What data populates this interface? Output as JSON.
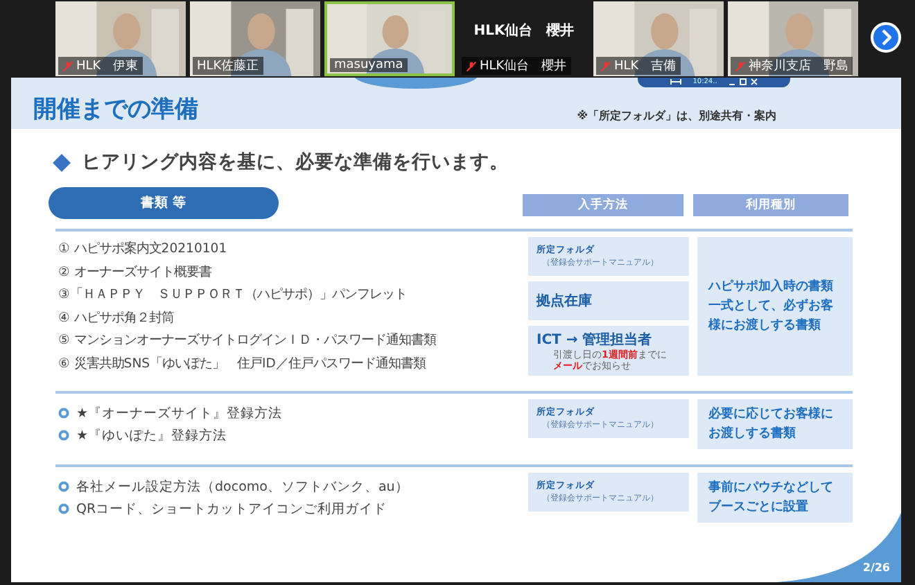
{
  "participants": [
    {
      "name": "HLK　伊東",
      "muted": true,
      "selected": false,
      "kind": "video"
    },
    {
      "name": "HLK佐藤正",
      "muted": false,
      "selected": false,
      "kind": "video"
    },
    {
      "name": "masuyama",
      "muted": false,
      "selected": true,
      "kind": "video"
    },
    {
      "name": "HLK仙台　櫻井",
      "muted": true,
      "selected": false,
      "kind": "name_only",
      "display_name": "HLK仙台　櫻井"
    },
    {
      "name": "HLK　吉備",
      "muted": true,
      "selected": false,
      "kind": "video"
    },
    {
      "name": "神奈川支店　野島",
      "muted": true,
      "selected": false,
      "kind": "video"
    }
  ],
  "share_toolbar": {
    "time": "10:24.."
  },
  "slide": {
    "title": "開催までの準備",
    "note": "※「所定フォルダ」は、別途共有・案内",
    "heading": "ヒアリング内容を基に、必要な準備を行います。",
    "category": "書類 等",
    "column_headers": [
      "入手方法",
      "利用種別"
    ],
    "sections": [
      {
        "items": [
          {
            "kind": "numbered",
            "text": "① ハピサポ案内文20210101"
          },
          {
            "kind": "numbered",
            "text": "② オーナーズサイト概要書"
          },
          {
            "kind": "numbered",
            "text": "③「ＨＡＰＰＹ　ＳＵＰＰＯＲＴ（ハピサポ）」パンフレット"
          },
          {
            "kind": "numbered",
            "text": "④ ハピサポ角２封筒"
          },
          {
            "kind": "numbered",
            "text": "⑤ マンションオーナーズサイトログインＩＤ・パスワード通知書類"
          },
          {
            "kind": "numbered",
            "text": "⑥ 災害共助SNS「ゆいぽた」　住戸ID／住戸パスワード通知書類"
          }
        ],
        "methods": [
          {
            "kind": "folder",
            "title": "所定フォルダ",
            "sub": "（登録会サポートマニュアル）"
          },
          {
            "kind": "plain",
            "title": "拠点在庫"
          },
          {
            "kind": "ict",
            "title": "ICT → 管理担当者",
            "notes": [
              "引渡し日の**1週間前**までに",
              "**メール**でお知らせ"
            ]
          }
        ],
        "usage": "ハピサポ加入時の書類一式として、必ずお客様にお渡しする書類"
      },
      {
        "items": [
          {
            "kind": "bullet",
            "text": "★『オーナーズサイト』登録方法"
          },
          {
            "kind": "bullet",
            "text": "★『ゆいぽた』登録方法"
          }
        ],
        "methods": [
          {
            "kind": "folder",
            "title": "所定フォルダ",
            "sub": "（登録会サポートマニュアル）"
          }
        ],
        "usage": "必要に応じてお客様にお渡しする書類"
      },
      {
        "items": [
          {
            "kind": "bullet",
            "text": "各社メール設定方法（docomo、ソフトバンク、au）"
          },
          {
            "kind": "bullet",
            "text": "QRコード、ショートカットアイコンご利用ガイド"
          }
        ],
        "methods": [
          {
            "kind": "folder",
            "title": "所定フォルダ",
            "sub": "（登録会サポートマニュアル）"
          }
        ],
        "usage": "事前にパウチなどしてブースごとに設置"
      }
    ],
    "page": "2/26"
  }
}
